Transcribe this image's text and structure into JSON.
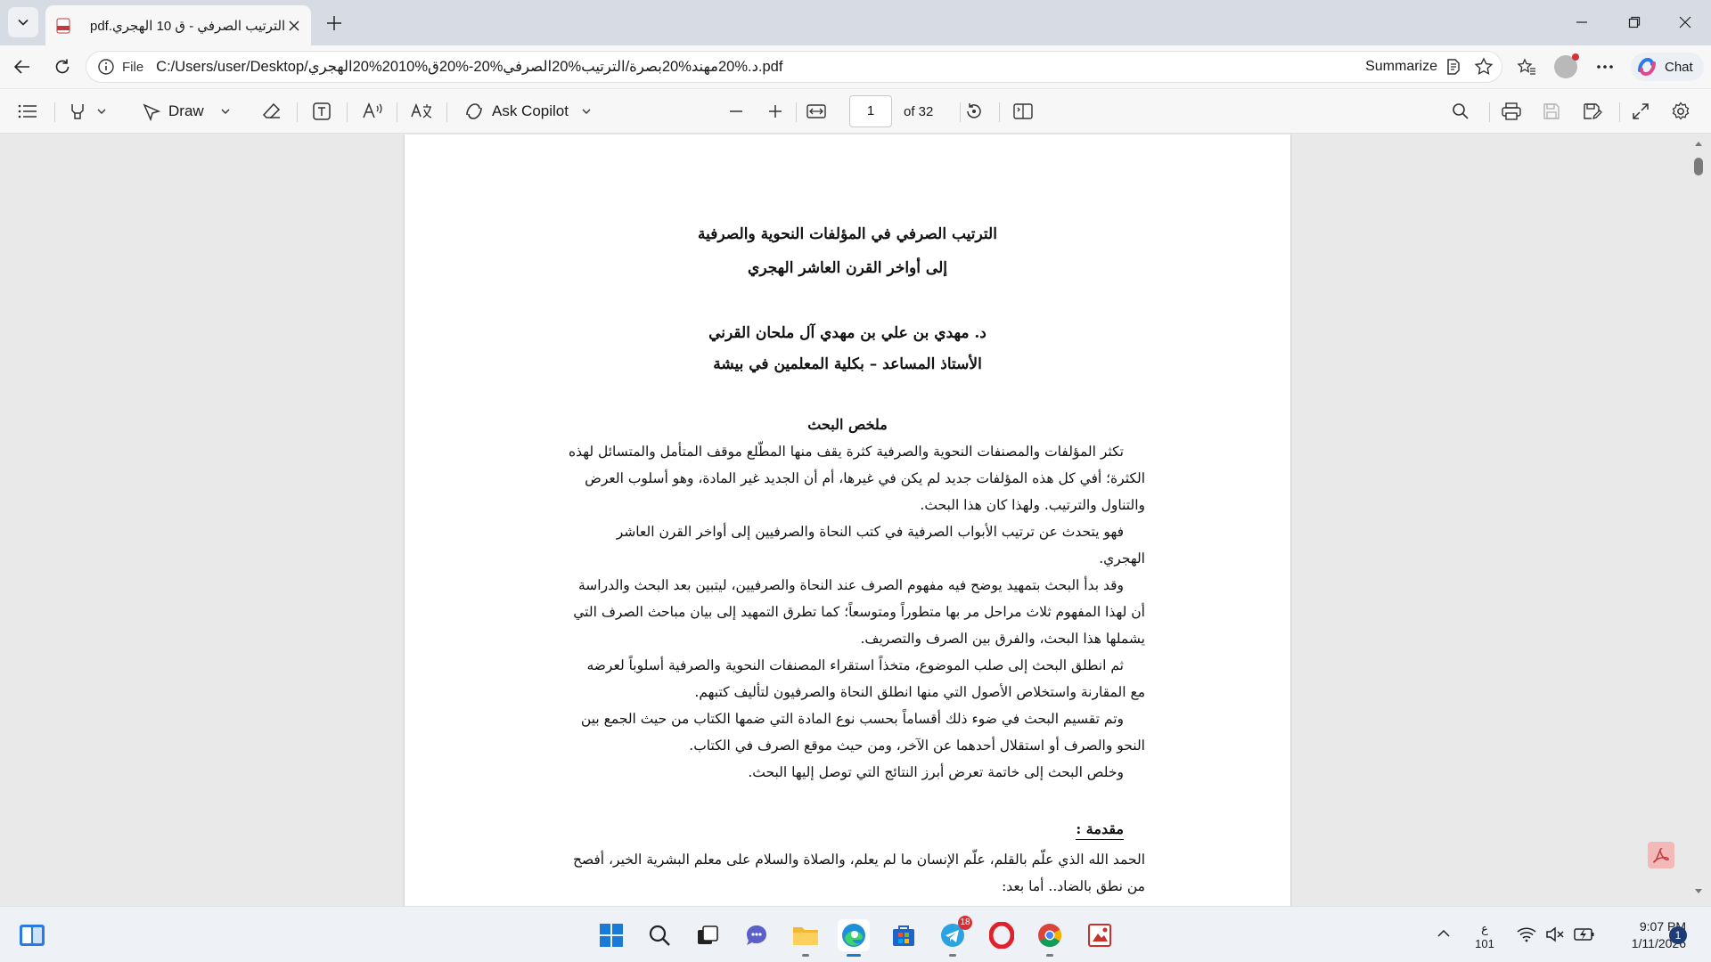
{
  "browser": {
    "tab_title": "pdf.الترتيب الصرفي - ق 10 الهجري",
    "file_label": "File",
    "url": "C:/Users/user/Desktop/د.%20مهند%20بصرة/الترتيب%20الصرفي%20-%20ق%2010%20الهجري.pdf",
    "summarize_label": "Summarize",
    "chat_label": "Chat"
  },
  "pdf_toolbar": {
    "draw_label": "Draw",
    "ask_copilot_label": "Ask Copilot",
    "page_number": "1",
    "page_of": "of 32"
  },
  "document": {
    "title_line1": "الترتيب الصرفي في المؤلفات النحوية والصرفية",
    "title_line2": "إلى أواخر القرن العاشر الهجري",
    "author": "د. مهدي بن علي بن مهدي آل ملحان القرني",
    "affiliation": "الأستاذ المساعد – بكلية المعلمين في بيشة",
    "abstract_heading": "ملخص البحث",
    "lines": [
      "تكثر المؤلفات والمصنفات النحوية والصرفية كثرة يقف منها المطّلع موقف المتأمل والمتسائل لهذه",
      "الكثرة؛ أفي كل هذه المؤلفات جديد لم يكن في غيرها، أم أن الجديد غير المادة، وهو أسلوب العرض",
      "والتناول والترتيب. ولهذا كان هذا البحث.",
      "فهو يتحدث عن ترتيب الأبواب الصرفية في كتب النحاة والصرفيين إلى أواخر القرن العاشر",
      "الهجري.",
      "وقد بدأ البحث بتمهيد يوضح فيه مفهوم الصرف عند النحاة والصرفيين، ليتبين بعد البحث والدراسة",
      "أن لهذا المفهوم ثلاث مراحل مر بها متطوراً ومتوسعاً؛ كما تطرق التمهيد إلى بيان مباحث الصرف التي",
      "يشملها هذا البحث، والفرق بين الصرف والتصريف.",
      "ثم انطلق البحث إلى صلب الموضوع، متخذاً استقراء المصنفات النحوية والصرفية أسلوباً لعرضه",
      "مع المقارنة واستخلاص الأصول التي منها انطلق النحاة والصرفيون لتأليف كتبهم.",
      "وتم تقسيم البحث في ضوء ذلك أقساماً بحسب نوع المادة التي ضمها الكتاب من حيث الجمع بين",
      "النحو والصرف أو استقلال أحدهما عن الآخر، ومن حيث موقع الصرف في الكتاب.",
      "وخلص البحث إلى خاتمة تعرض أبرز النتائج التي توصل إليها البحث."
    ],
    "intro_heading": "مقدمة :",
    "intro_lines": [
      "الحمد الله الذي علّم بالقلم، علّم الإنسان ما لم يعلم، والصلاة والسلام على معلم البشرية الخير، أفصح",
      "من نطق بالضاد.. أما بعد:"
    ]
  },
  "taskbar": {
    "telegram_badge": "18",
    "lang_char": "ع",
    "lang_code": "101",
    "time": "9:07 PM",
    "date": "1/11/2026",
    "notifications": "1"
  }
}
